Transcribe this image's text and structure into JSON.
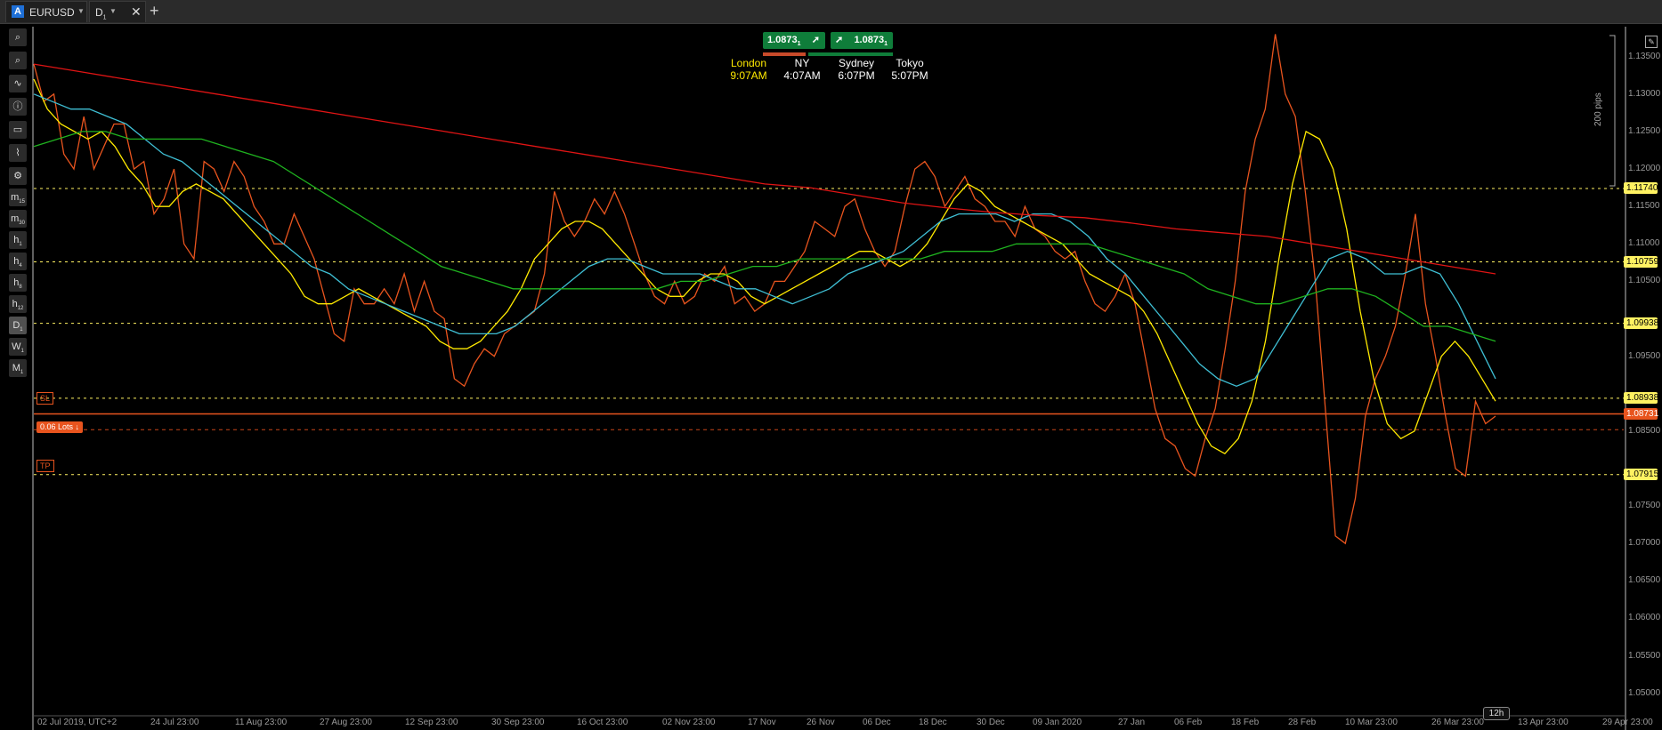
{
  "tabs": {
    "symbol_tab": {
      "label": "EURUSD"
    },
    "timeframe_tab": {
      "label": "D",
      "sub": "1"
    }
  },
  "toolbar": [
    {
      "icon": "zoom-in-icon",
      "glyph": "⌕"
    },
    {
      "icon": "zoom-out-icon",
      "glyph": "⌕"
    },
    {
      "icon": "indicators-icon",
      "glyph": "∿"
    },
    {
      "icon": "info-icon",
      "glyph": "ⓘ"
    },
    {
      "icon": "chart-type-icon",
      "glyph": "▭"
    },
    {
      "icon": "drawing-icon",
      "glyph": "⌇"
    },
    {
      "icon": "settings-icon",
      "glyph": "⚙"
    },
    {
      "label": "m",
      "sub": "15"
    },
    {
      "label": "m",
      "sub": "30"
    },
    {
      "label": "h",
      "sub": "1"
    },
    {
      "label": "h",
      "sub": "4"
    },
    {
      "label": "h",
      "sub": "8"
    },
    {
      "label": "h",
      "sub": "12"
    },
    {
      "label": "D",
      "sub": "1",
      "selected": true
    },
    {
      "label": "W",
      "sub": "1"
    },
    {
      "label": "M",
      "sub": "1"
    }
  ],
  "trade_buttons": {
    "sell_price": "1.0873",
    "sell_sup": "1",
    "buy_price": "1.0873",
    "buy_sup": "1"
  },
  "sessions": [
    {
      "name": "London",
      "time": "9:07AM",
      "active": true
    },
    {
      "name": "NY",
      "time": "4:07AM"
    },
    {
      "name": "Sydney",
      "time": "6:07PM"
    },
    {
      "name": "Tokyo",
      "time": "5:07PM"
    }
  ],
  "pips_label": "200 pips",
  "timeframe_badge": "12h",
  "orders": {
    "sl_label": "SL",
    "tp_label": "TP",
    "lots_label": "0.06 Lots"
  },
  "chart_data": {
    "type": "line",
    "symbol": "EURUSD",
    "timeframe": "D1",
    "ylim": [
      1.047,
      1.139
    ],
    "y_ticks": [
      "1.13500",
      "1.13000",
      "1.12500",
      "1.12000",
      "1.11500",
      "1.11000",
      "1.10500",
      "1.09500",
      "1.08500",
      "1.07500",
      "1.07000",
      "1.06500",
      "1.06000",
      "1.05500",
      "1.05000"
    ],
    "x_ticks": [
      "02 Jul 2019, UTC+2",
      "24 Jul 23:00",
      "11 Aug 23:00",
      "27 Aug 23:00",
      "12 Sep 23:00",
      "30 Sep 23:00",
      "16 Oct 23:00",
      "02 Nov 23:00",
      "17 Nov",
      "26 Nov",
      "06 Dec",
      "18 Dec",
      "30 Dec",
      "09 Jan 2020",
      "27 Jan",
      "06 Feb",
      "18 Feb",
      "28 Feb",
      "10 Mar 23:00",
      "26 Mar 23:00",
      "13 Apr 23:00",
      "29 Apr 23:00"
    ],
    "horizontal_levels": [
      {
        "label": "1.11740",
        "value": 1.1174
      },
      {
        "label": "1.10759",
        "value": 1.1076
      },
      {
        "label": "1.09938",
        "value": 1.0994
      },
      {
        "label": "1.08938",
        "value": 1.0894
      },
      {
        "label": "1.07915",
        "value": 1.0792
      }
    ],
    "current_price": {
      "label": "1.08731",
      "value": 1.0873
    },
    "order_line": 1.0852,
    "series": [
      {
        "color": "#e8541e",
        "values": [
          1.134,
          1.129,
          1.13,
          1.122,
          1.12,
          1.127,
          1.12,
          1.123,
          1.126,
          1.126,
          1.12,
          1.121,
          1.114,
          1.116,
          1.12,
          1.11,
          1.108,
          1.121,
          1.12,
          1.117,
          1.121,
          1.119,
          1.115,
          1.113,
          1.11,
          1.11,
          1.114,
          1.111,
          1.108,
          1.103,
          1.098,
          1.097,
          1.104,
          1.102,
          1.102,
          1.104,
          1.102,
          1.106,
          1.101,
          1.105,
          1.101,
          1.1,
          1.092,
          1.091,
          1.094,
          1.096,
          1.095,
          1.098,
          1.099,
          1.1,
          1.101,
          1.106,
          1.117,
          1.113,
          1.111,
          1.113,
          1.116,
          1.114,
          1.117,
          1.114,
          1.11,
          1.106,
          1.103,
          1.102,
          1.105,
          1.102,
          1.103,
          1.106,
          1.105,
          1.107,
          1.102,
          1.103,
          1.101,
          1.102,
          1.105,
          1.105,
          1.107,
          1.109,
          1.113,
          1.112,
          1.111,
          1.115,
          1.116,
          1.112,
          1.109,
          1.107,
          1.109,
          1.115,
          1.12,
          1.121,
          1.119,
          1.115,
          1.117,
          1.119,
          1.116,
          1.115,
          1.113,
          1.113,
          1.111,
          1.115,
          1.112,
          1.111,
          1.109,
          1.108,
          1.109,
          1.105,
          1.102,
          1.101,
          1.103,
          1.106,
          1.102,
          1.095,
          1.088,
          1.084,
          1.083,
          1.08,
          1.079,
          1.084,
          1.088,
          1.096,
          1.105,
          1.117,
          1.124,
          1.128,
          1.138,
          1.13,
          1.127,
          1.117,
          1.105,
          1.088,
          1.071,
          1.07,
          1.076,
          1.087,
          1.092,
          1.095,
          1.099,
          1.106,
          1.114,
          1.102,
          1.095,
          1.087,
          1.08,
          1.079,
          1.089,
          1.086,
          1.087
        ]
      },
      {
        "color": "#ffea00",
        "values": [
          1.132,
          1.128,
          1.126,
          1.125,
          1.124,
          1.125,
          1.123,
          1.12,
          1.118,
          1.115,
          1.115,
          1.117,
          1.118,
          1.117,
          1.116,
          1.114,
          1.112,
          1.11,
          1.108,
          1.106,
          1.103,
          1.102,
          1.102,
          1.103,
          1.104,
          1.103,
          1.102,
          1.101,
          1.1,
          1.099,
          1.097,
          1.096,
          1.096,
          1.097,
          1.099,
          1.101,
          1.104,
          1.108,
          1.11,
          1.112,
          1.113,
          1.113,
          1.112,
          1.11,
          1.108,
          1.106,
          1.104,
          1.103,
          1.103,
          1.105,
          1.106,
          1.106,
          1.105,
          1.103,
          1.102,
          1.103,
          1.104,
          1.105,
          1.106,
          1.107,
          1.108,
          1.109,
          1.109,
          1.108,
          1.107,
          1.108,
          1.11,
          1.113,
          1.116,
          1.118,
          1.117,
          1.115,
          1.114,
          1.113,
          1.112,
          1.111,
          1.11,
          1.108,
          1.106,
          1.105,
          1.104,
          1.103,
          1.101,
          1.098,
          1.094,
          1.09,
          1.086,
          1.083,
          1.082,
          1.084,
          1.089,
          1.097,
          1.108,
          1.118,
          1.125,
          1.124,
          1.12,
          1.112,
          1.101,
          1.092,
          1.086,
          1.084,
          1.085,
          1.09,
          1.095,
          1.097,
          1.095,
          1.092,
          1.089
        ]
      },
      {
        "color": "#3fbfd4",
        "values": [
          1.13,
          1.129,
          1.128,
          1.128,
          1.127,
          1.126,
          1.124,
          1.122,
          1.121,
          1.119,
          1.117,
          1.115,
          1.113,
          1.111,
          1.109,
          1.107,
          1.106,
          1.104,
          1.103,
          1.102,
          1.101,
          1.1,
          1.099,
          1.098,
          1.098,
          1.098,
          1.099,
          1.101,
          1.103,
          1.105,
          1.107,
          1.108,
          1.108,
          1.107,
          1.106,
          1.106,
          1.106,
          1.105,
          1.104,
          1.104,
          1.103,
          1.102,
          1.103,
          1.104,
          1.106,
          1.107,
          1.108,
          1.109,
          1.111,
          1.113,
          1.114,
          1.114,
          1.114,
          1.113,
          1.114,
          1.114,
          1.113,
          1.111,
          1.108,
          1.106,
          1.103,
          1.1,
          1.097,
          1.094,
          1.092,
          1.091,
          1.092,
          1.096,
          1.1,
          1.104,
          1.108,
          1.109,
          1.108,
          1.106,
          1.106,
          1.107,
          1.106,
          1.102,
          1.097,
          1.092
        ]
      },
      {
        "color": "#1fb31f",
        "values": [
          1.123,
          1.124,
          1.125,
          1.125,
          1.124,
          1.124,
          1.124,
          1.124,
          1.123,
          1.122,
          1.121,
          1.119,
          1.117,
          1.115,
          1.113,
          1.111,
          1.109,
          1.107,
          1.106,
          1.105,
          1.104,
          1.104,
          1.104,
          1.104,
          1.104,
          1.104,
          1.104,
          1.105,
          1.105,
          1.106,
          1.107,
          1.107,
          1.108,
          1.108,
          1.108,
          1.108,
          1.108,
          1.108,
          1.109,
          1.109,
          1.109,
          1.11,
          1.11,
          1.11,
          1.11,
          1.109,
          1.108,
          1.107,
          1.106,
          1.104,
          1.103,
          1.102,
          1.102,
          1.103,
          1.104,
          1.104,
          1.103,
          1.101,
          1.099,
          1.099,
          1.098,
          1.097
        ]
      },
      {
        "color": "#e01414",
        "values": [
          1.134,
          1.133,
          1.132,
          1.131,
          1.13,
          1.129,
          1.128,
          1.127,
          1.126,
          1.125,
          1.124,
          1.123,
          1.122,
          1.121,
          1.12,
          1.119,
          1.118,
          1.1175,
          1.1165,
          1.1155,
          1.1148,
          1.1142,
          1.1138,
          1.1135,
          1.1128,
          1.112,
          1.1115,
          1.111,
          1.11,
          1.109,
          1.108,
          1.107,
          1.106
        ]
      }
    ]
  }
}
